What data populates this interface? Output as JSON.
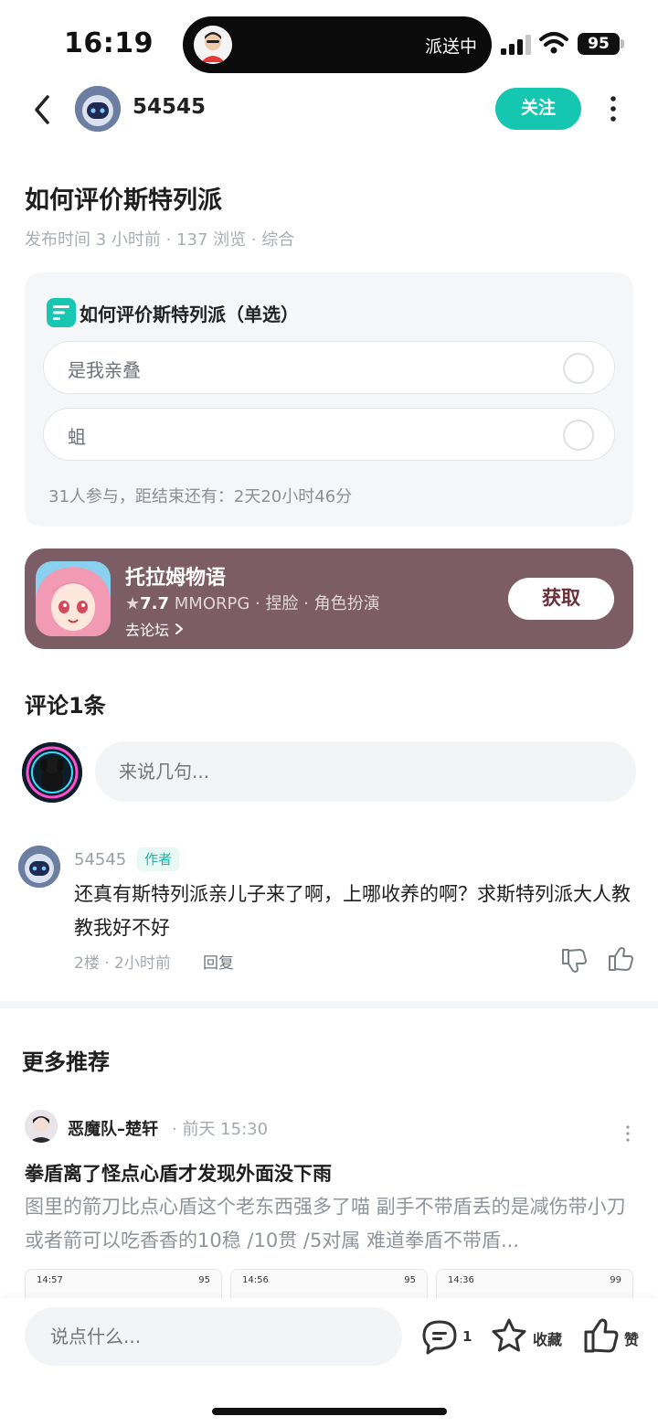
{
  "status_bar": {
    "time": "16:19",
    "live_activity": "派送中",
    "battery": "95"
  },
  "header": {
    "author_name": "54545",
    "follow_label": "关注"
  },
  "post": {
    "title": "如何评价斯特列派",
    "meta": "发布时间 3 小时前 · 137 浏览 · 综合"
  },
  "poll": {
    "title": "如何评价斯特列派（单选）",
    "options": [
      {
        "label": "是我亲叠"
      },
      {
        "label": "蛆"
      }
    ],
    "footer": "31人参与，距结束还有：2天20小时46分"
  },
  "game_card": {
    "name": "托拉姆物语",
    "rating": "7.7",
    "tags": "MMORPG · 捏脸 · 角色扮演",
    "forum_link": "去论坛",
    "get_label": "获取"
  },
  "comments": {
    "title": "评论1条",
    "input_placeholder": "来说几句...",
    "items": [
      {
        "author": "54545",
        "badge": "作者",
        "text": "还真有斯特列派亲儿子来了啊，上哪收养的啊？求斯特列派大人教教我好不好",
        "meta": "2楼 · 2小时前",
        "reply_label": "回复"
      }
    ]
  },
  "recommendations": {
    "title": "更多推荐",
    "items": [
      {
        "author": "恶魔队–楚轩",
        "time": "· 前天 15:30",
        "title": "拳盾离了怪点心盾才发现外面没下雨",
        "excerpt": "图里的箭刀比点心盾这个老东西强多了喵  副手不带盾丢的是减伤带小刀或者箭可以吃香香的10稳 /10贯 /5对属  难道拳盾不带盾...",
        "thumbs": [
          {
            "time": "14:57",
            "status": "95"
          },
          {
            "time": "14:56",
            "status": "95"
          },
          {
            "time": "14:36",
            "status": "99"
          }
        ]
      }
    ]
  },
  "bottom_bar": {
    "input_placeholder": "说点什么...",
    "comment_count": "1",
    "fav_label": "收藏",
    "like_label": "赞"
  },
  "colors": {
    "accent": "#15c6b0",
    "game_card_bg": "#7c5d66"
  }
}
